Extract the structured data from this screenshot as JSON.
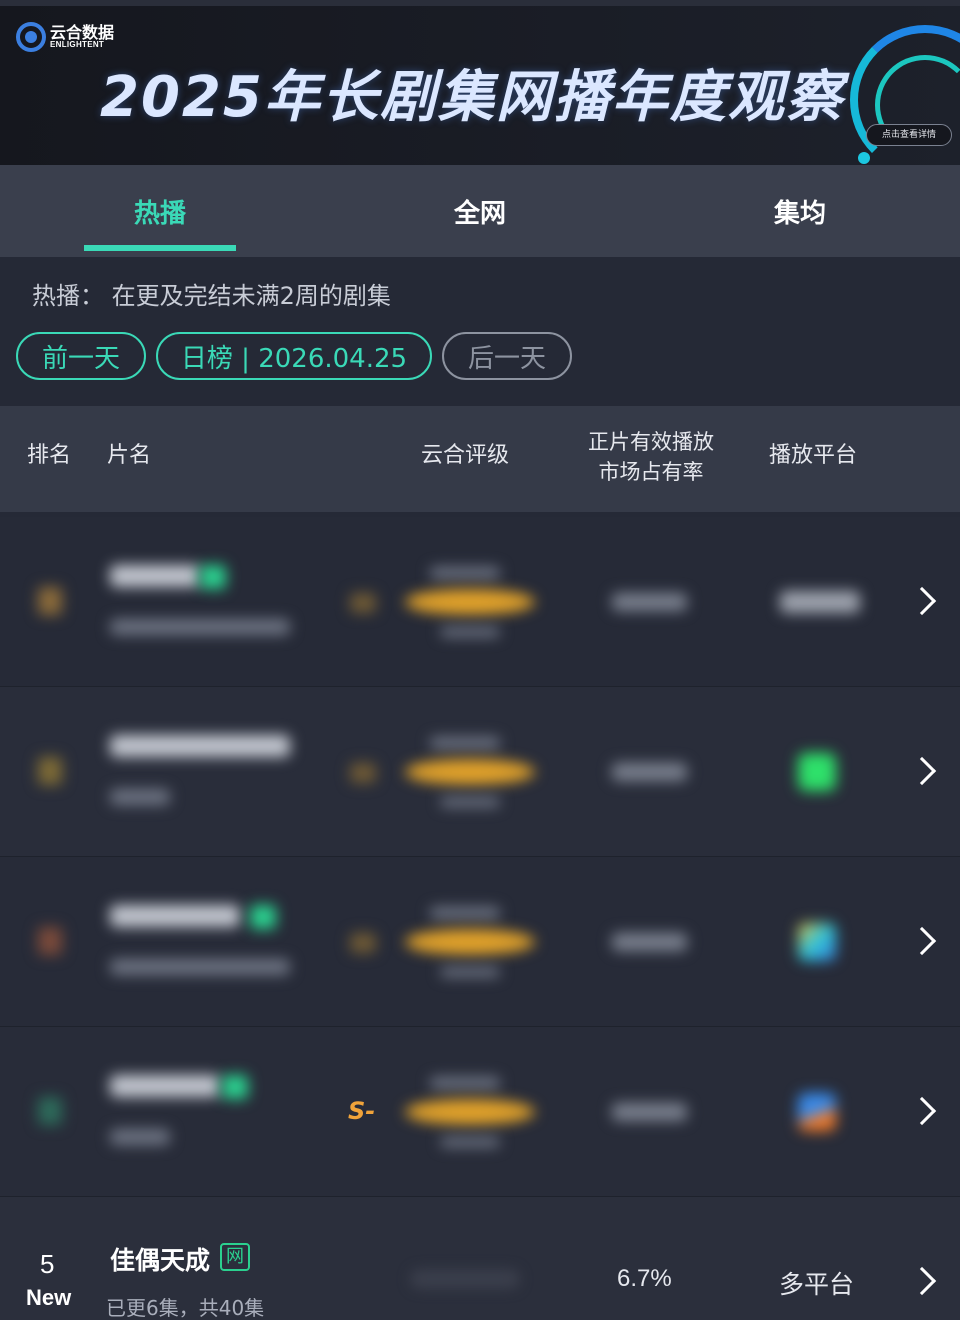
{
  "banner": {
    "logo_cn": "云合数据",
    "logo_en": "ENLIGHTENT",
    "title": "2025年长剧集网播年度观察",
    "detail_button": "点击查看详情"
  },
  "tabs": [
    {
      "label": "热播",
      "active": true
    },
    {
      "label": "全网",
      "active": false
    },
    {
      "label": "集均",
      "active": false
    }
  ],
  "description": "热播：  在更及完结未满2周的剧集",
  "date_nav": {
    "prev": "前一天",
    "date": "日榜 | 2026.04.25",
    "next": "后一天"
  },
  "table": {
    "headers": {
      "rank": "排名",
      "name": "片名",
      "rating": "云合评级",
      "share_line1": "正片有效播放",
      "share_line2": "市场占有率",
      "platform": "播放平台"
    },
    "rows": [
      {
        "blurred": true,
        "platform_icon": "multi-platform"
      },
      {
        "blurred": true,
        "platform_icon": "green-app-icon"
      },
      {
        "blurred": true,
        "platform_icon": "multicolor-app-icon"
      },
      {
        "blurred": true,
        "rating_partial": "S-",
        "platform_icon": "blue-orange-app-icon"
      },
      {
        "blurred": false,
        "rank": "5",
        "badge": "New",
        "title": "佳偶天成",
        "tag": "网",
        "subtitle": "已更6集，共40集",
        "share": "6.7%",
        "platform": "多平台"
      }
    ]
  },
  "colors": {
    "accent": "#3ad9b7",
    "rating_gold": "#e0a12a",
    "tag_green": "#2bd08f"
  }
}
